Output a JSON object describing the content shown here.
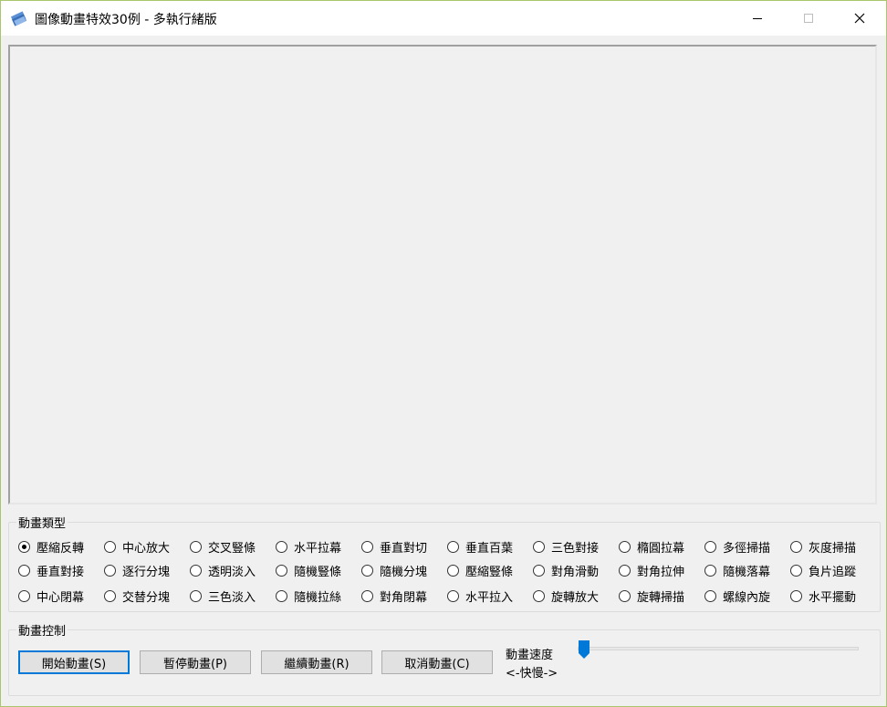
{
  "window": {
    "title": "圖像動畫特效30例 - 多執行緒版",
    "controls": {
      "minimize": "minimize-icon",
      "maximize": "maximize-icon",
      "close": "close-icon"
    }
  },
  "animation_types": {
    "group_label": "動畫類型",
    "selected_index": 0,
    "items": [
      "壓縮反轉",
      "中心放大",
      "交叉豎條",
      "水平拉幕",
      "垂直對切",
      "垂直百葉",
      "三色對接",
      "橢圓拉幕",
      "多徑掃描",
      "灰度掃描",
      "垂直對接",
      "逐行分塊",
      "透明淡入",
      "隨機豎條",
      "隨機分塊",
      "壓縮豎條",
      "對角滑動",
      "對角拉伸",
      "隨機落幕",
      "負片追蹤",
      "中心閉幕",
      "交替分塊",
      "三色淡入",
      "隨機拉絲",
      "對角閉幕",
      "水平拉入",
      "旋轉放大",
      "旋轉掃描",
      "螺線內旋",
      "水平擺動"
    ]
  },
  "animation_control": {
    "group_label": "動畫控制",
    "buttons": {
      "start": "開始動畫(S)",
      "pause": "暫停動畫(P)",
      "resume": "繼續動畫(R)",
      "cancel": "取消動畫(C)"
    },
    "speed_label": "動畫速度",
    "speed_hint": "<-快慢->",
    "speed_value": 0
  },
  "colors": {
    "accent": "#0078d7",
    "border": "#a8c66c"
  }
}
